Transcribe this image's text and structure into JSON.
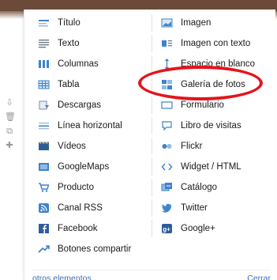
{
  "elements": {
    "left": [
      {
        "key": "titulo",
        "label": "Título",
        "icon": "title-icon"
      },
      {
        "key": "texto",
        "label": "Texto",
        "icon": "text-icon"
      },
      {
        "key": "columnas",
        "label": "Columnas",
        "icon": "columns-icon"
      },
      {
        "key": "tabla",
        "label": "Tabla",
        "icon": "table-icon"
      },
      {
        "key": "descargas",
        "label": "Descargas",
        "icon": "download-icon"
      },
      {
        "key": "linea",
        "label": "Línea horizontal",
        "icon": "horizontal-line-icon"
      },
      {
        "key": "videos",
        "label": "Vídeos",
        "icon": "video-icon"
      },
      {
        "key": "googlemaps",
        "label": "GoogleMaps",
        "icon": "map-icon"
      },
      {
        "key": "producto",
        "label": "Producto",
        "icon": "shopping-cart-icon"
      },
      {
        "key": "rss",
        "label": "Canal RSS",
        "icon": "rss-icon"
      },
      {
        "key": "facebook",
        "label": "Facebook",
        "icon": "facebook-icon"
      },
      {
        "key": "compartir",
        "label": "Botones compartir",
        "icon": "share-icon"
      }
    ],
    "right": [
      {
        "key": "imagen",
        "label": "Imagen",
        "icon": "image-icon"
      },
      {
        "key": "imagen-texto",
        "label": "Imagen con texto",
        "icon": "image-with-text-icon"
      },
      {
        "key": "espacio",
        "label": "Espacio en blanco",
        "icon": "blank-space-icon"
      },
      {
        "key": "galeria",
        "label": "Galería de fotos",
        "icon": "photo-gallery-icon"
      },
      {
        "key": "formulario",
        "label": "Formulario",
        "icon": "form-icon"
      },
      {
        "key": "libro",
        "label": "Libro de visitas",
        "icon": "guestbook-icon"
      },
      {
        "key": "flickr",
        "label": "Flickr",
        "icon": "flickr-icon"
      },
      {
        "key": "widget",
        "label": "Widget / HTML",
        "icon": "code-icon"
      },
      {
        "key": "catalogo",
        "label": "Catálogo",
        "icon": "catalog-icon"
      },
      {
        "key": "twitter",
        "label": "Twitter",
        "icon": "twitter-icon"
      },
      {
        "key": "googleplus",
        "label": "Google+",
        "icon": "google-plus-icon"
      }
    ]
  },
  "footer": {
    "more_label": "otros elementos",
    "close_label": "Cerrar"
  },
  "highlight": {
    "target": "Galería de fotos",
    "color": "#e5141b"
  },
  "colors": {
    "link": "#3b6fb6",
    "icon_blue": "#3f83c9",
    "top_bar": "#6b4a3a"
  }
}
